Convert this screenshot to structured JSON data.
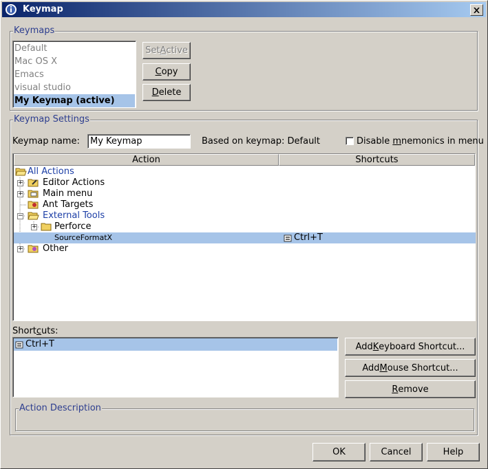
{
  "window": {
    "title": "Keymap",
    "title_icon": "info-icon",
    "close_icon": "close-icon"
  },
  "keymaps": {
    "group_title": "Keymaps",
    "items": [
      {
        "label": "Default",
        "selected": false
      },
      {
        "label": "Mac OS X",
        "selected": false
      },
      {
        "label": "Emacs",
        "selected": false
      },
      {
        "label": "visual studio",
        "selected": false
      },
      {
        "label": "My Keymap (active)",
        "selected": true
      }
    ],
    "set_active": {
      "pre": "Set ",
      "mn": "A",
      "post": "ctive"
    },
    "copy": {
      "pre": "",
      "mn": "C",
      "post": "opy"
    },
    "delete": {
      "pre": "",
      "mn": "D",
      "post": "elete"
    }
  },
  "settings": {
    "group_title": "Keymap Settings",
    "name_label": "Keymap name:",
    "name_value": "My Keymap",
    "based_on": "Based on keymap: Default",
    "disable_mnemonics": {
      "pre": "Disable ",
      "mn": "m",
      "post": "nemonics in menu",
      "checked": false
    }
  },
  "table": {
    "col_action": "Action",
    "col_shortcuts": "Shortcuts",
    "rows": [
      {
        "label": "All Actions",
        "link": true,
        "icon": "folder-open-icon",
        "shortcut": ""
      },
      {
        "label": "Editor Actions",
        "icon": "editor-folder-icon",
        "shortcut": ""
      },
      {
        "label": "Main menu",
        "icon": "menu-folder-icon",
        "shortcut": ""
      },
      {
        "label": "Ant Targets",
        "icon": "ant-folder-icon",
        "shortcut": ""
      },
      {
        "label": "External Tools",
        "link": true,
        "icon": "folder-open-icon",
        "shortcut": ""
      },
      {
        "label": "Perforce",
        "icon": "folder-icon",
        "shortcut": ""
      },
      {
        "label": "SourceFormatX",
        "icon": "",
        "shortcut": "Ctrl+T",
        "selected": true
      },
      {
        "label": "Other",
        "icon": "other-folder-icon",
        "shortcut": ""
      }
    ]
  },
  "shortcuts": {
    "label": {
      "pre": "Short",
      "mn": "c",
      "post": "uts:"
    },
    "items": [
      {
        "label": "Ctrl+T",
        "icon": "keyboard-icon",
        "selected": true
      }
    ],
    "add_keyboard": {
      "pre": "Add ",
      "mn": "K",
      "post": "eyboard Shortcut..."
    },
    "add_mouse": {
      "pre": "Add ",
      "mn": "M",
      "post": "ouse Shortcut..."
    },
    "remove": {
      "pre": "",
      "mn": "R",
      "post": "emove"
    }
  },
  "description": {
    "group_title": "Action Description"
  },
  "footer": {
    "ok": "OK",
    "cancel": "Cancel",
    "help": "Help"
  },
  "colors": {
    "selection": "#a6c4e8",
    "link": "#1c3ea6",
    "title_start": "#0a246a"
  }
}
